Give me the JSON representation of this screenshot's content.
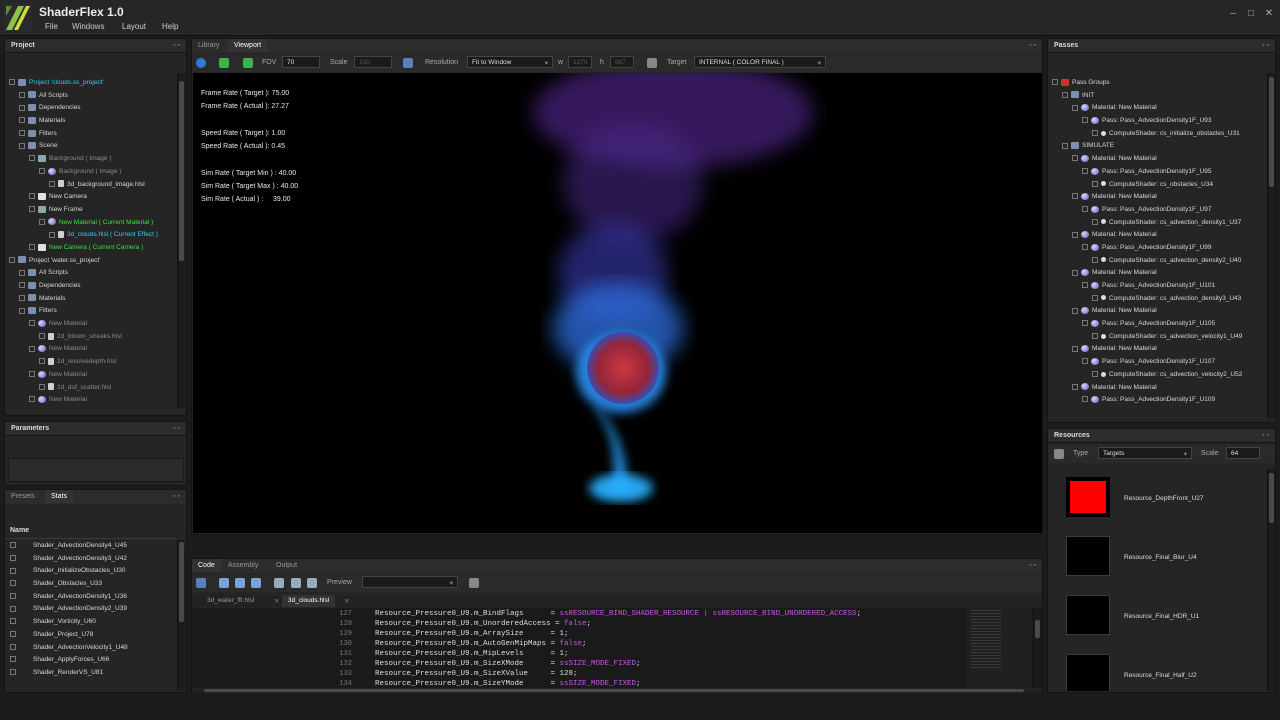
{
  "app": {
    "title": "ShaderFlex 1.0"
  },
  "menu": [
    "File",
    "Windows",
    "Layout",
    "Help"
  ],
  "colors": {
    "accent_cyan": "#27d4e6",
    "accent_green": "#3ee03e",
    "keyword_purple": "#c259e4",
    "resource_red": "#ff0000"
  },
  "project": {
    "header": "Project",
    "rows": [
      {
        "label": "Project 'clouds.ss_project'",
        "depth": 0,
        "cls": "cyan",
        "icon": "project-icon"
      },
      {
        "label": "All Scripts",
        "depth": 1,
        "cls": "",
        "icon": "folder-icon"
      },
      {
        "label": "Dependencies",
        "depth": 1,
        "cls": "",
        "icon": "folder-icon"
      },
      {
        "label": "Materials",
        "depth": 1,
        "cls": "",
        "icon": "folder-icon"
      },
      {
        "label": "Filters",
        "depth": 1,
        "cls": "",
        "icon": "folder-icon"
      },
      {
        "label": "Scene",
        "depth": 1,
        "cls": "",
        "icon": "folder-icon"
      },
      {
        "label": "Background ( Image )",
        "depth": 2,
        "cls": "grey",
        "icon": "frame-icon"
      },
      {
        "label": "Background ( Image )",
        "depth": 3,
        "cls": "grey",
        "icon": "material-icon"
      },
      {
        "label": "3d_background_image.hlsl",
        "depth": 4,
        "cls": "",
        "icon": "file-icon"
      },
      {
        "label": "New Camera",
        "depth": 2,
        "cls": "",
        "icon": "camera-icon"
      },
      {
        "label": "New Frame",
        "depth": 2,
        "cls": "",
        "icon": "frame-icon"
      },
      {
        "label": "New Material ( Current Material )",
        "depth": 3,
        "cls": "green",
        "icon": "material-icon"
      },
      {
        "label": "3d_clouds.hlsl ( Current Effect )",
        "depth": 4,
        "cls": "cyan",
        "icon": "file-icon"
      },
      {
        "label": "New Camera ( Current Camera )",
        "depth": 2,
        "cls": "green",
        "icon": "camera-icon"
      },
      {
        "label": "Project 'water.ss_project'",
        "depth": 0,
        "cls": "",
        "icon": "project-icon"
      },
      {
        "label": "All Scripts",
        "depth": 1,
        "cls": "",
        "icon": "folder-icon"
      },
      {
        "label": "Dependencies",
        "depth": 1,
        "cls": "",
        "icon": "folder-icon"
      },
      {
        "label": "Materials",
        "depth": 1,
        "cls": "",
        "icon": "folder-icon"
      },
      {
        "label": "Filters",
        "depth": 1,
        "cls": "",
        "icon": "folder-icon"
      },
      {
        "label": "New Material",
        "depth": 2,
        "cls": "grey",
        "icon": "material-icon"
      },
      {
        "label": "2d_bloom_streaks.hlsl",
        "depth": 3,
        "cls": "grey",
        "icon": "file-icon"
      },
      {
        "label": "New Material",
        "depth": 2,
        "cls": "grey",
        "icon": "material-icon"
      },
      {
        "label": "2d_resolvedepth.hlsl",
        "depth": 3,
        "cls": "grey",
        "icon": "file-icon"
      },
      {
        "label": "New Material",
        "depth": 2,
        "cls": "grey",
        "icon": "material-icon"
      },
      {
        "label": "2d_dof_scatter.hlsl",
        "depth": 3,
        "cls": "grey",
        "icon": "file-icon"
      },
      {
        "label": "New Material",
        "depth": 2,
        "cls": "grey",
        "icon": "material-icon"
      }
    ]
  },
  "parameters": {
    "header": "Parameters"
  },
  "stats": {
    "tabs": [
      "Presets",
      "Stats"
    ],
    "column": "Name",
    "rows": [
      "Shader_AdvectionDensity4_U45",
      "Shader_AdvectionDensity3_U42",
      "Shader_InitializeObstacles_U30",
      "Shader_Obstacles_U33",
      "Shader_AdvectionDensity1_U36",
      "Shader_AdvectionDensity2_U39",
      "Shader_Vorticity_U60",
      "Shader_Project_U78",
      "Shader_AdvectionVelocity1_U48",
      "Shader_ApplyForces_U66",
      "Shader_RenderVS_U81"
    ]
  },
  "viewport": {
    "tabs": [
      "Library",
      "Viewport"
    ],
    "toolbar": {
      "fov_label": "FOV",
      "fov_value": "70",
      "scale_label": "Scale",
      "scale_value": "100",
      "resolution_label": "Resolution",
      "resolution_value": "Fit to Window",
      "w_label": "w",
      "w_value": "1270",
      "h_label": "h",
      "h_value": "687",
      "target_label": "Target",
      "target_value": "INTERNAL ( COLOR FINAL )"
    },
    "stats": [
      "Frame Rate ( Target ): 75.00",
      "Frame Rate ( Actual ): 27.27",
      "",
      "Speed Rate ( Target ): 1.00",
      "Speed Rate ( Actual ): 0.45",
      "",
      "Sim Rate ( Target Min ) : 40.00",
      "Sim Rate ( Target Max ) : 40.00",
      "Sim Rate ( Actual ) :     39.00"
    ]
  },
  "code": {
    "tabs": [
      "Code",
      "Assembly",
      "Output"
    ],
    "preview_label": "Preview",
    "file_tabs": [
      "3d_water_fft.hlsl",
      "3d_clouds.hlsl"
    ],
    "lines": [
      {
        "n": "127",
        "pre": "Resource_Pressure0_U9.m_BindFlags      = ",
        "kw": "ssRESOURCE_BIND_SHADER_RESOURCE | ssRESOURCE_BIND_UNORDERED_ACCESS",
        "post": ";"
      },
      {
        "n": "128",
        "pre": "Resource_Pressure0_U9.m_UnorderedAccess = ",
        "kw": "false",
        "post": ";"
      },
      {
        "n": "129",
        "pre": "Resource_Pressure0_U9.m_ArraySize      = 1;",
        "kw": "",
        "post": ""
      },
      {
        "n": "130",
        "pre": "Resource_Pressure0_U9.m_AutoGenMipMaps = ",
        "kw": "false",
        "post": ";"
      },
      {
        "n": "131",
        "pre": "Resource_Pressure0_U9.m_MipLevels      = 1;",
        "kw": "",
        "post": ""
      },
      {
        "n": "132",
        "pre": "Resource_Pressure0_U9.m_SizeXMode      = ",
        "kw": "ssSIZE_MODE_FIXED",
        "post": ";"
      },
      {
        "n": "133",
        "pre": "Resource_Pressure0_U9.m_SizeXValue     = 128;",
        "kw": "",
        "post": ""
      },
      {
        "n": "134",
        "pre": "Resource_Pressure0_U9.m_SizeYMode      = ",
        "kw": "ssSIZE_MODE_FIXED",
        "post": ";"
      }
    ]
  },
  "passes": {
    "header": "Passes",
    "rows": [
      {
        "label": "Pass Groups",
        "depth": 0,
        "icon": "passgroups-icon"
      },
      {
        "label": "INIT",
        "depth": 1,
        "icon": "folder-icon"
      },
      {
        "label": "Material: New Material",
        "depth": 2,
        "icon": "material-icon"
      },
      {
        "label": "Pass: Pass_AdvectionDensity1F_U93",
        "depth": 3,
        "icon": "pass-icon"
      },
      {
        "label": "ComputeShader: cs_initialize_obstacles_U31",
        "depth": 4,
        "icon": "dot-icon"
      },
      {
        "label": "SIMULATE",
        "depth": 1,
        "icon": "folder-icon"
      },
      {
        "label": "Material: New Material",
        "depth": 2,
        "icon": "material-icon"
      },
      {
        "label": "Pass: Pass_AdvectionDensity1F_U95",
        "depth": 3,
        "icon": "pass-icon"
      },
      {
        "label": "ComputeShader: cs_obstacles_U34",
        "depth": 4,
        "icon": "dot-icon"
      },
      {
        "label": "Material: New Material",
        "depth": 2,
        "icon": "material-icon"
      },
      {
        "label": "Pass: Pass_AdvectionDensity1F_U97",
        "depth": 3,
        "icon": "pass-icon"
      },
      {
        "label": "ComputeShader: cs_advection_density1_U37",
        "depth": 4,
        "icon": "dot-icon"
      },
      {
        "label": "Material: New Material",
        "depth": 2,
        "icon": "material-icon"
      },
      {
        "label": "Pass: Pass_AdvectionDensity1F_U99",
        "depth": 3,
        "icon": "pass-icon"
      },
      {
        "label": "ComputeShader: cs_advection_density2_U40",
        "depth": 4,
        "icon": "dot-icon"
      },
      {
        "label": "Material: New Material",
        "depth": 2,
        "icon": "material-icon"
      },
      {
        "label": "Pass: Pass_AdvectionDensity1F_U101",
        "depth": 3,
        "icon": "pass-icon"
      },
      {
        "label": "ComputeShader: cs_advection_density3_U43",
        "depth": 4,
        "icon": "dot-icon"
      },
      {
        "label": "Material: New Material",
        "depth": 2,
        "icon": "material-icon"
      },
      {
        "label": "Pass: Pass_AdvectionDensity1F_U105",
        "depth": 3,
        "icon": "pass-icon"
      },
      {
        "label": "ComputeShader: cs_advection_velocity1_U49",
        "depth": 4,
        "icon": "dot-icon"
      },
      {
        "label": "Material: New Material",
        "depth": 2,
        "icon": "material-icon"
      },
      {
        "label": "Pass: Pass_AdvectionDensity1F_U107",
        "depth": 3,
        "icon": "pass-icon"
      },
      {
        "label": "ComputeShader: cs_advection_velocity2_U52",
        "depth": 4,
        "icon": "dot-icon"
      },
      {
        "label": "Material: New Material",
        "depth": 2,
        "icon": "material-icon"
      },
      {
        "label": "Pass: Pass_AdvectionDensity1F_U109",
        "depth": 3,
        "icon": "pass-icon"
      }
    ]
  },
  "resources": {
    "header": "Resources",
    "type_label": "Type",
    "type_value": "Targets",
    "scale_label": "Scale",
    "scale_value": "64",
    "items": [
      {
        "name": "Resource_DepthFront_U27",
        "color": "#ff0000"
      },
      {
        "name": "Resource_Final_Blur_U4",
        "color": "#000000"
      },
      {
        "name": "Resource_Final_HDR_U1",
        "color": "#000000"
      },
      {
        "name": "Resource_Final_Half_U2",
        "color": "#000000"
      }
    ]
  }
}
